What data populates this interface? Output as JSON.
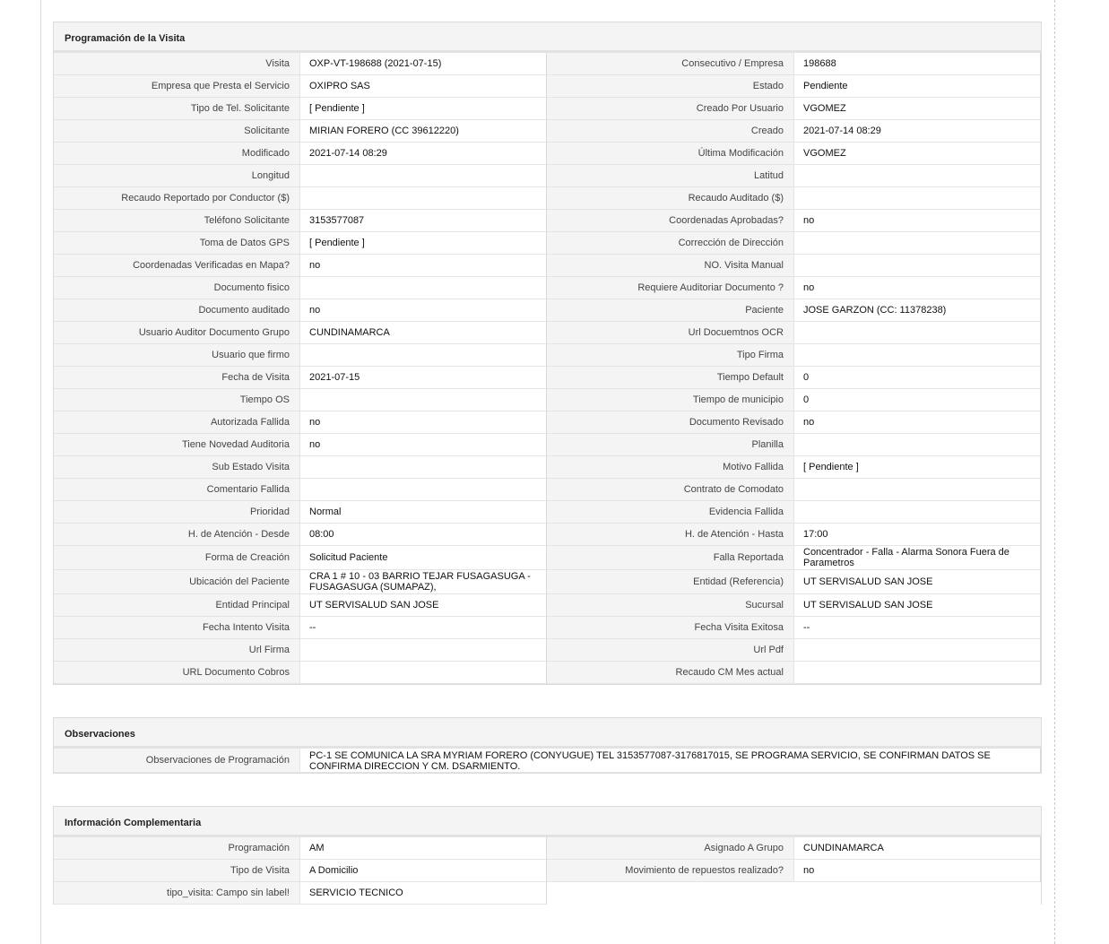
{
  "sections": {
    "programacion": {
      "title": "Programación de la Visita",
      "rows": [
        {
          "l1": "Visita",
          "v1": "OXP-VT-198688 (2021-07-15)",
          "l2": "Consecutivo / Empresa",
          "v2": "198688"
        },
        {
          "l1": "Empresa que Presta el Servicio",
          "v1": "OXIPRO SAS",
          "l2": "Estado",
          "v2": "Pendiente"
        },
        {
          "l1": "Tipo de Tel. Solicitante",
          "v1": "[ Pendiente ]",
          "l2": "Creado Por Usuario",
          "v2": "VGOMEZ"
        },
        {
          "l1": "Solicitante",
          "v1": "MIRIAN FORERO (CC 39612220)",
          "l2": "Creado",
          "v2": "2021-07-14 08:29"
        },
        {
          "l1": "Modificado",
          "v1": "2021-07-14 08:29",
          "l2": "Última Modificación",
          "v2": " VGOMEZ"
        },
        {
          "l1": "Longitud",
          "v1": "",
          "l2": "Latitud",
          "v2": ""
        },
        {
          "l1": "Recaudo Reportado por Conductor ($)",
          "v1": "",
          "l2": "Recaudo Auditado ($)",
          "v2": ""
        },
        {
          "l1": "Teléfono Solicitante",
          "v1": "3153577087",
          "l2": "Coordenadas Aprobadas?",
          "v2": " no"
        },
        {
          "l1": "Toma de Datos GPS",
          "v1": "[ Pendiente ]",
          "l2": "Corrección de Dirección",
          "v2": ""
        },
        {
          "l1": "Coordenadas Verificadas en Mapa?",
          "v1": " no",
          "l2": "NO. Visita Manual",
          "v2": ""
        },
        {
          "l1": "Documento fisico",
          "v1": "",
          "l2": "Requiere Auditoriar Documento ?",
          "v2": " no"
        },
        {
          "l1": "Documento auditado",
          "v1": " no",
          "l2": "Paciente",
          "v2": "JOSE GARZON (CC: 11378238)"
        },
        {
          "l1": "Usuario Auditor Documento Grupo",
          "v1": "CUNDINAMARCA",
          "l2": "Url Docuemtnos OCR",
          "v2": ""
        },
        {
          "l1": "Usuario que firmo",
          "v1": "",
          "l2": "Tipo Firma",
          "v2": ""
        },
        {
          "l1": "Fecha de Visita",
          "v1": " 2021-07-15",
          "l2": "Tiempo Default",
          "v2": "0"
        },
        {
          "l1": "Tiempo OS",
          "v1": "",
          "l2": "Tiempo de municipio",
          "v2": "0"
        },
        {
          "l1": "Autorizada Fallida",
          "v1": " no",
          "l2": "Documento Revisado",
          "v2": " no"
        },
        {
          "l1": "Tiene Novedad Auditoria",
          "v1": " no",
          "l2": "Planilla",
          "v2": ""
        },
        {
          "l1": "Sub Estado Visita",
          "v1": "",
          "l2": "Motivo Fallida",
          "v2": "[ Pendiente ]"
        },
        {
          "l1": "Comentario Fallida",
          "v1": "",
          "l2": "Contrato de Comodato",
          "v2": ""
        },
        {
          "l1": "Prioridad",
          "v1": "Normal",
          "l2": "Evidencia Fallida",
          "v2": ""
        },
        {
          "l1": "H. de Atención - Desde",
          "v1": "08:00",
          "l2": "H. de Atención - Hasta",
          "v2": "17:00"
        },
        {
          "l1": "Forma de Creación",
          "v1": "Solicitud Paciente",
          "l2": "Falla Reportada",
          "v2": "Concentrador - Falla - Alarma Sonora Fuera de Parametros",
          "tall": true
        },
        {
          "l1": "Ubicación del Paciente",
          "v1": "CRA 1 # 10 - 03 BARRIO TEJAR FUSAGASUGA - FUSAGASUGA (SUMAPAZ),",
          "l2": "Entidad (Referencia)",
          "v2": "UT SERVISALUD SAN JOSE",
          "tall": true
        },
        {
          "l1": "Entidad Principal",
          "v1": "UT SERVISALUD SAN JOSE",
          "l2": "Sucursal",
          "v2": "UT SERVISALUD SAN JOSE"
        },
        {
          "l1": "Fecha Intento Visita",
          "v1": " --",
          "l2": "Fecha Visita Exitosa",
          "v2": " --"
        },
        {
          "l1": "Url Firma",
          "v1": "",
          "l2": "Url Pdf",
          "v2": ""
        },
        {
          "l1": "URL Documento Cobros",
          "v1": "",
          "l2": "Recaudo CM Mes actual",
          "v2": ""
        }
      ]
    },
    "observaciones": {
      "title": "Observaciones",
      "label": "Observaciones de Programación",
      "value": "  PC-1 SE COMUNICA LA SRA MYRIAM FORERO (CONYUGUE) TEL 3153577087-3176817015, SE PROGRAMA SERVICIO, SE CONFIRMAN DATOS SE CONFIRMA DIRECCION Y CM. DSARMIENTO."
    },
    "complementaria": {
      "title": "Información Complementaria",
      "rows": [
        {
          "l1": "Programación",
          "v1": "AM",
          "l2": "Asignado A Grupo",
          "v2": "CUNDINAMARCA"
        },
        {
          "l1": "Tipo de Visita",
          "v1": "A Domicilio",
          "l2": "Movimiento de repuestos realizado?",
          "v2": " no"
        },
        {
          "l1": "tipo_visita: Campo sin label!",
          "v1": "SERVICIO TECNICO"
        }
      ]
    }
  }
}
